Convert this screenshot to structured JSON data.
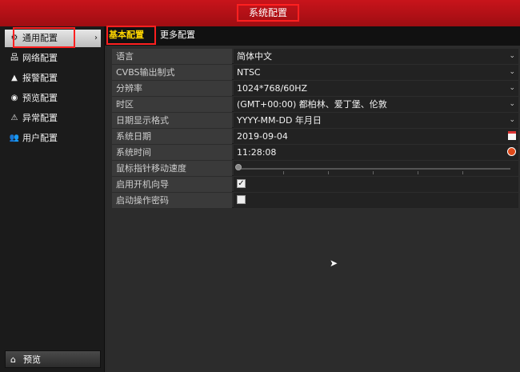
{
  "window": {
    "title": "系统配置"
  },
  "sidebar": {
    "items": [
      {
        "label": "通用配置",
        "icon": "gear-icon",
        "glyph": "⚙",
        "active": true
      },
      {
        "label": "网络配置",
        "icon": "network-icon",
        "glyph": "品"
      },
      {
        "label": "报警配置",
        "icon": "alarm-icon",
        "glyph": "▲"
      },
      {
        "label": "预览配置",
        "icon": "eye-icon",
        "glyph": "◉"
      },
      {
        "label": "异常配置",
        "icon": "warning-icon",
        "glyph": "⚠"
      },
      {
        "label": "用户配置",
        "icon": "users-icon",
        "glyph": "👥"
      }
    ],
    "active_arrow": "›",
    "bottom": {
      "label": "预览",
      "icon": "home-icon",
      "glyph": "⌂"
    }
  },
  "tabs": [
    {
      "label": "基本配置",
      "active": true
    },
    {
      "label": "更多配置",
      "active": false
    }
  ],
  "settings": [
    {
      "label": "语言",
      "value": "简体中文",
      "type": "select"
    },
    {
      "label": "CVBS输出制式",
      "value": "NTSC",
      "type": "select"
    },
    {
      "label": "分辨率",
      "value": "1024*768/60HZ",
      "type": "select"
    },
    {
      "label": "时区",
      "value": "(GMT+00:00) 都柏林、爱丁堡、伦敦",
      "type": "select"
    },
    {
      "label": "日期显示格式",
      "value": "YYYY-MM-DD 年月日",
      "type": "select"
    },
    {
      "label": "系统日期",
      "value": "2019-09-04",
      "type": "date"
    },
    {
      "label": "系统时间",
      "value": "11:28:08",
      "type": "time"
    },
    {
      "label": "鼠标指针移动速度",
      "value": "",
      "type": "slider",
      "level": 0.0
    },
    {
      "label": "启用开机向导",
      "value": "",
      "type": "checkbox",
      "checked": true
    },
    {
      "label": "启动操作密码",
      "value": "",
      "type": "checkbox",
      "checked": false
    }
  ],
  "colors": {
    "titlebar": "#b31016",
    "highlight": "#ff2020",
    "active_tab": "#ffd500"
  }
}
